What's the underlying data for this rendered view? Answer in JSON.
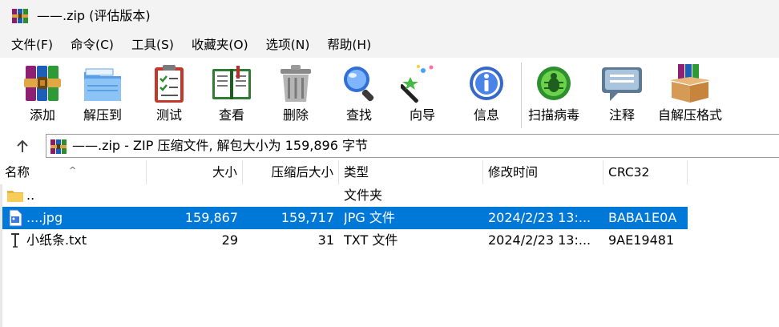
{
  "window": {
    "title": "——.zip (评估版本)"
  },
  "menu": {
    "items": [
      {
        "label": "文件(F)"
      },
      {
        "label": "命令(C)"
      },
      {
        "label": "工具(S)"
      },
      {
        "label": "收藏夹(O)"
      },
      {
        "label": "选项(N)"
      },
      {
        "label": "帮助(H)"
      }
    ]
  },
  "toolbar": {
    "add": "添加",
    "extract": "解压到",
    "test": "测试",
    "view": "查看",
    "delete": "删除",
    "find": "查找",
    "wizard": "向导",
    "info": "信息",
    "scan": "扫描病毒",
    "comment": "注释",
    "sfx": "自解压格式"
  },
  "address": {
    "text": "——.zip - ZIP 压缩文件, 解包大小为 159,896 字节"
  },
  "columns": {
    "name": "名称",
    "size": "大小",
    "packed": "压缩后大小",
    "type": "类型",
    "modified": "修改时间",
    "crc": "CRC32"
  },
  "rows": [
    {
      "name": "..",
      "size": "",
      "packed": "",
      "type": "文件夹",
      "modified": "",
      "crc": "",
      "icon": "folder-icon",
      "selected": false
    },
    {
      "name": "....jpg",
      "size": "159,867",
      "packed": "159,717",
      "type": "JPG 文件",
      "modified": "2024/2/23 13:...",
      "crc": "BABA1E0A",
      "icon": "image-file-icon",
      "selected": true
    },
    {
      "name": "小纸条.txt",
      "size": "29",
      "packed": "31",
      "type": "TXT 文件",
      "modified": "2024/2/23 13:...",
      "crc": "9AE19481",
      "icon": "text-file-icon",
      "selected": false
    }
  ],
  "colors": {
    "selection": "#0078d7",
    "chrome": "#f3f3f3"
  }
}
